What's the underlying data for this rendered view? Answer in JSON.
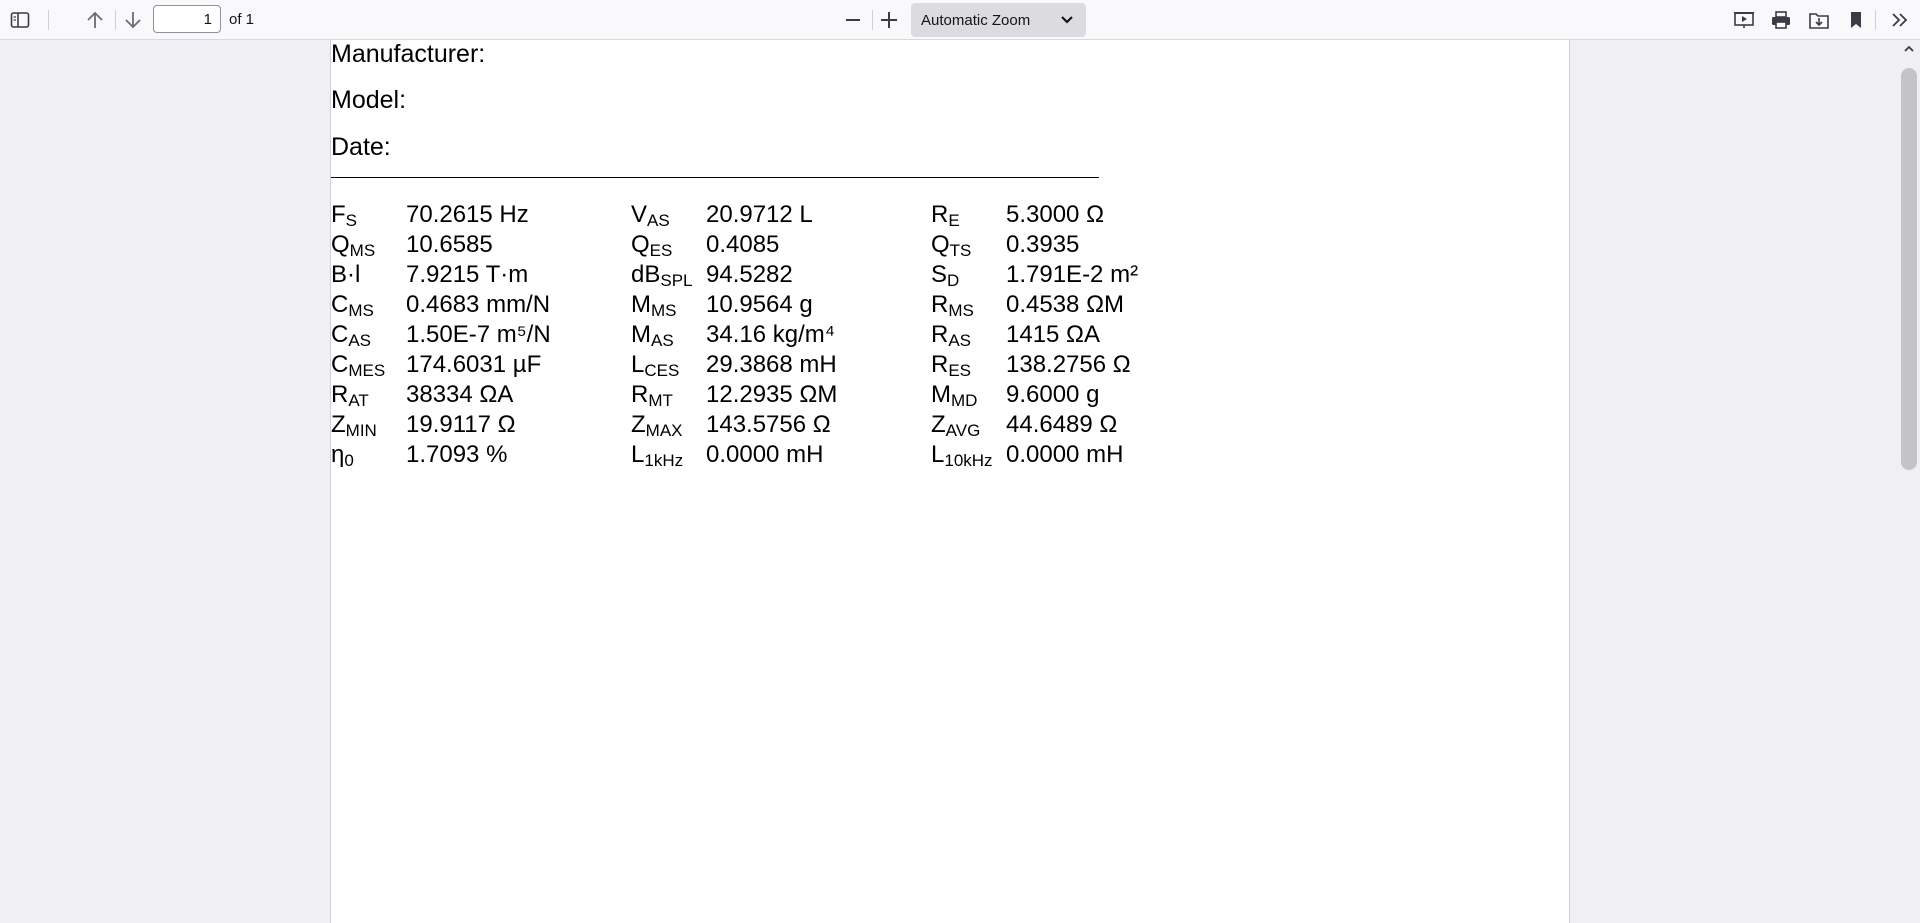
{
  "toolbar": {
    "page_number": "1",
    "page_of": "of 1",
    "zoom_label": "Automatic Zoom",
    "icons": {
      "sidebar": "sidebar-toggle-icon",
      "prev": "arrow-up-icon",
      "next": "arrow-down-icon",
      "zoom_out": "minus-icon",
      "zoom_in": "plus-icon",
      "presentation": "presentation-icon",
      "print": "printer-icon",
      "save": "download-icon",
      "bookmark": "bookmark-icon",
      "more": "double-chevron-right-icon"
    }
  },
  "document": {
    "manufacturer_label": "Manufacturer:",
    "model_label": "Model:",
    "date_label": "Date:",
    "params": [
      [
        {
          "name": "F",
          "sub": "S",
          "value": "70.2615 Hz"
        },
        {
          "name": "V",
          "sub": "AS",
          "value": "20.9712 L"
        },
        {
          "name": "R",
          "sub": "E",
          "value": "5.3000 Ω"
        }
      ],
      [
        {
          "name": "Q",
          "sub": "MS",
          "value": "10.6585"
        },
        {
          "name": "Q",
          "sub": "ES",
          "value": "0.4085"
        },
        {
          "name": "Q",
          "sub": "TS",
          "value": "0.3935"
        }
      ],
      [
        {
          "name": "B·l",
          "sub": "",
          "value": "7.9215 T·m"
        },
        {
          "name": "dB",
          "sub": "SPL",
          "value": "94.5282"
        },
        {
          "name": "S",
          "sub": "D",
          "value": "1.791E-2 m²"
        }
      ],
      [
        {
          "name": "C",
          "sub": "MS",
          "value": "0.4683 mm/N"
        },
        {
          "name": "M",
          "sub": "MS",
          "value": "10.9564 g"
        },
        {
          "name": "R",
          "sub": "MS",
          "value": "0.4538 ΩM"
        }
      ],
      [
        {
          "name": "C",
          "sub": "AS",
          "value": "1.50E-7 m⁵/N"
        },
        {
          "name": "M",
          "sub": "AS",
          "value": "34.16 kg/m⁴"
        },
        {
          "name": "R",
          "sub": "AS",
          "value": "1415 ΩA"
        }
      ],
      [
        {
          "name": "C",
          "sub": "MES",
          "value": "174.6031 µF"
        },
        {
          "name": "L",
          "sub": "CES",
          "value": "29.3868 mH"
        },
        {
          "name": "R",
          "sub": "ES",
          "value": "138.2756 Ω"
        }
      ],
      [
        {
          "name": "R",
          "sub": "AT",
          "value": "38334 ΩA"
        },
        {
          "name": "R",
          "sub": "MT",
          "value": "12.2935 ΩM"
        },
        {
          "name": "M",
          "sub": "MD",
          "value": "9.6000 g"
        }
      ],
      [
        {
          "name": "Z",
          "sub": "MIN",
          "value": "19.9117 Ω"
        },
        {
          "name": "Z",
          "sub": "MAX",
          "value": "143.5756 Ω"
        },
        {
          "name": "Z",
          "sub": "AVG",
          "value": "44.6489 Ω"
        }
      ],
      [
        {
          "name": "η",
          "sub": "0",
          "value": "1.7093 %"
        },
        {
          "name": "L",
          "sub": "1kHz",
          "value": "0.0000 mH"
        },
        {
          "name": "L",
          "sub": "10kHz",
          "value": "0.0000 mH"
        }
      ]
    ]
  }
}
